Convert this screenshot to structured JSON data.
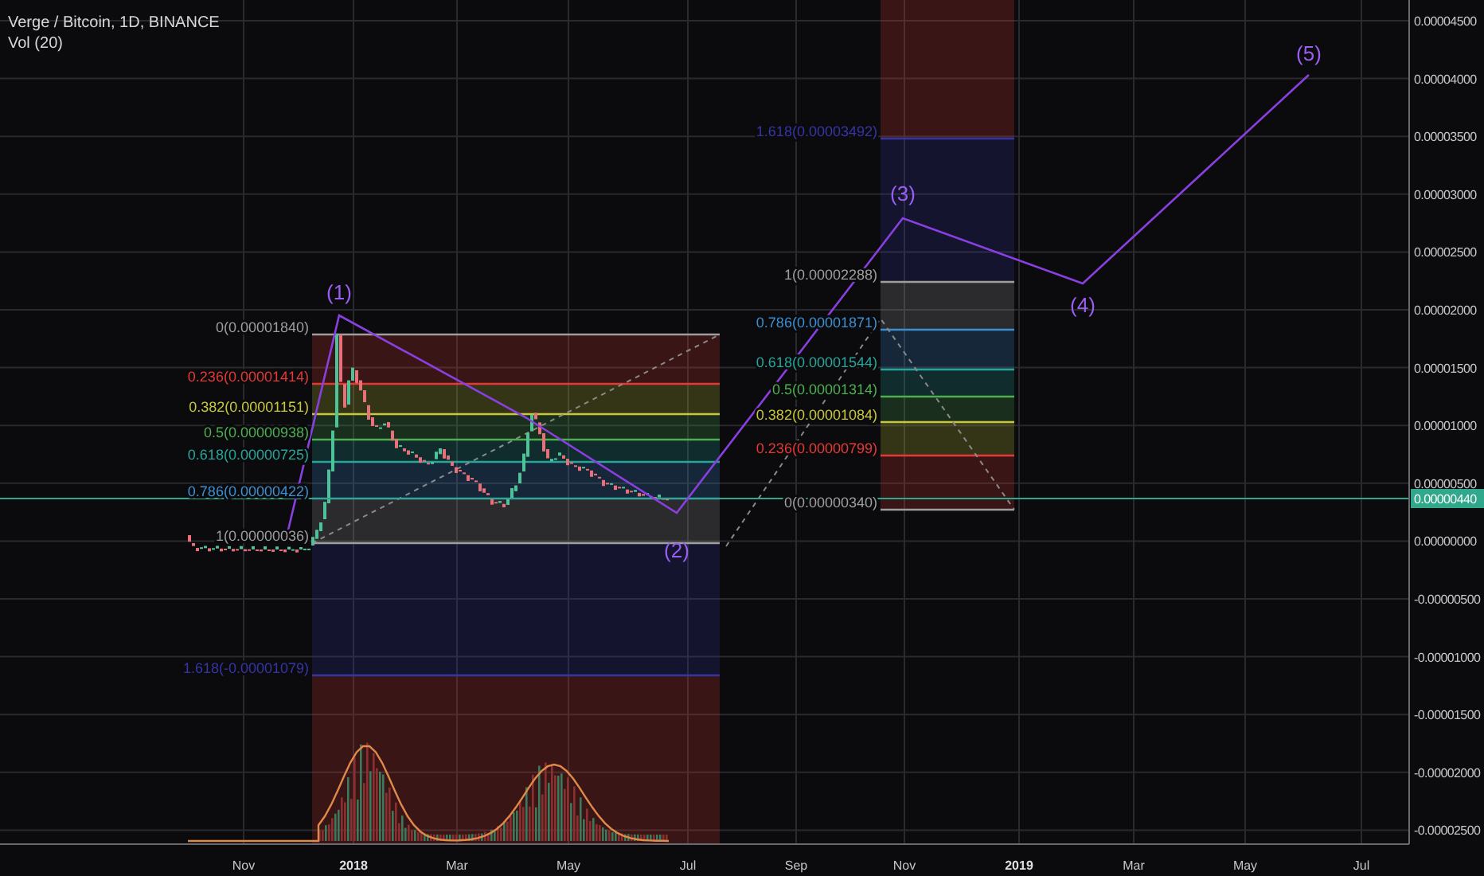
{
  "chart_header": {
    "symbol": "Verge / Bitcoin, 1D, BINANCE",
    "indicator": "Vol (20)"
  },
  "price_axis": {
    "ticks": [
      "0.00004500",
      "0.00004000",
      "0.00003500",
      "0.00003000",
      "0.00002500",
      "0.00002000",
      "0.00001500",
      "0.00001000",
      "0.00000500",
      "0.00000000",
      "-0.00000500",
      "-0.00001000",
      "-0.00001500",
      "-0.00002000",
      "-0.00002500"
    ],
    "last_price": "0.00000440"
  },
  "time_axis": {
    "ticks": [
      {
        "label": "Nov",
        "kind": "month"
      },
      {
        "label": "2018",
        "kind": "year"
      },
      {
        "label": "Mar",
        "kind": "month"
      },
      {
        "label": "May",
        "kind": "month"
      },
      {
        "label": "Jul",
        "kind": "month"
      },
      {
        "label": "Sep",
        "kind": "month"
      },
      {
        "label": "Nov",
        "kind": "month"
      },
      {
        "label": "2019",
        "kind": "year"
      },
      {
        "label": "Mar",
        "kind": "month"
      },
      {
        "label": "May",
        "kind": "month"
      },
      {
        "label": "Jul",
        "kind": "month"
      }
    ]
  },
  "fib_retracements": [
    {
      "levels": [
        {
          "label": "0(0.00001840)",
          "color": "#9e9e9e"
        },
        {
          "label": "0.236(0.00001414)",
          "color": "#e53935"
        },
        {
          "label": "0.382(0.00001151)",
          "color": "#c8c83a"
        },
        {
          "label": "0.5(0.00000938)",
          "color": "#4caf50"
        },
        {
          "label": "0.618(0.00000725)",
          "color": "#26a69a"
        },
        {
          "label": "0.786(0.00000422)",
          "color": "#3d8fd1"
        },
        {
          "label": "1(0.00000036)",
          "color": "#9e9e9e"
        },
        {
          "label": "1.618(-0.00001079)",
          "color": "#3535a8"
        }
      ]
    },
    {
      "levels": [
        {
          "label": "1.618(0.00003492)",
          "color": "#3535a8"
        },
        {
          "label": "1(0.00002288)",
          "color": "#9e9e9e"
        },
        {
          "label": "0.786(0.00001871)",
          "color": "#3d8fd1"
        },
        {
          "label": "0.618(0.00001544)",
          "color": "#26a69a"
        },
        {
          "label": "0.5(0.00001314)",
          "color": "#4caf50"
        },
        {
          "label": "0.382(0.00001084)",
          "color": "#c8c83a"
        },
        {
          "label": "0.236(0.00000799)",
          "color": "#e53935"
        },
        {
          "label": "0(0.00000340)",
          "color": "#9e9e9e"
        }
      ]
    }
  ],
  "wave_labels": [
    "(1)",
    "(2)",
    "(3)",
    "(4)",
    "(5)"
  ]
}
